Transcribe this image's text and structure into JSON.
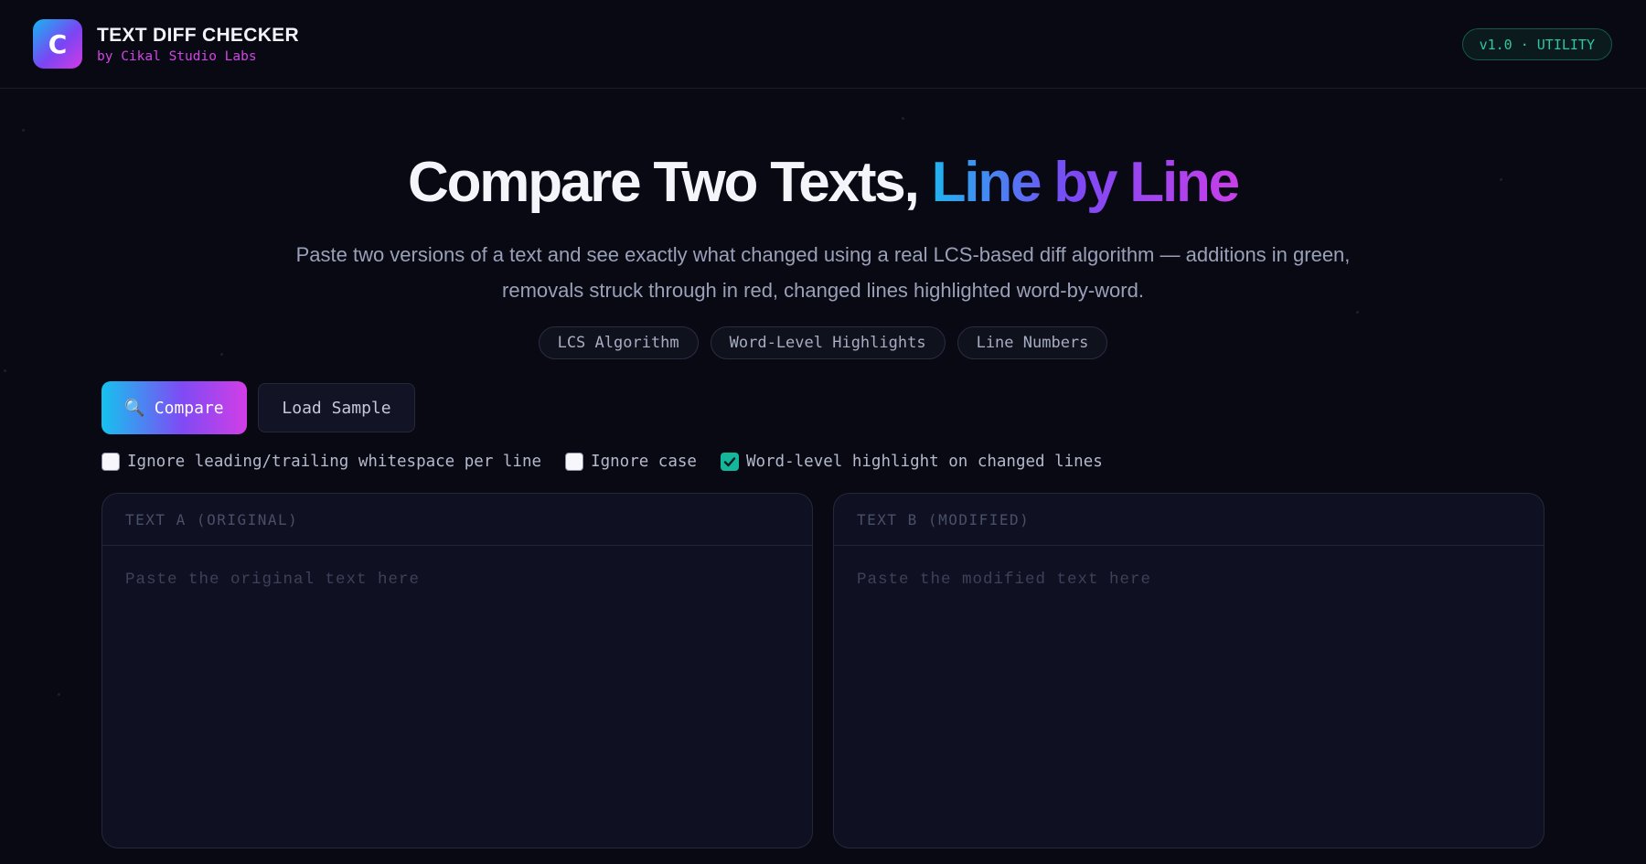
{
  "header": {
    "logo_letter": "C",
    "title": "TEXT DIFF CHECKER",
    "subtitle": "by Cikal Studio Labs",
    "version_badge": "v1.0 · UTILITY"
  },
  "hero": {
    "title_plain": "Compare Two Texts,",
    "title_highlight": "Line by Line",
    "description": "Paste two versions of a text and see exactly what changed using a real LCS-based diff algorithm — additions in green, removals struck through in red, changed lines highlighted word-by-word.",
    "chips": [
      "LCS Algorithm",
      "Word-Level Highlights",
      "Line Numbers"
    ]
  },
  "actions": {
    "compare_icon": "🔍",
    "compare_label": "Compare",
    "sample_label": "Load Sample"
  },
  "options": [
    {
      "label": "Ignore leading/trailing whitespace per line",
      "checked": false
    },
    {
      "label": "Ignore case",
      "checked": false
    },
    {
      "label": "Word-level highlight on changed lines",
      "checked": true
    }
  ],
  "panels": {
    "a": {
      "title": "TEXT A (ORIGINAL)",
      "placeholder": "Paste the original text here",
      "value": ""
    },
    "b": {
      "title": "TEXT B (MODIFIED)",
      "placeholder": "Paste the modified text here",
      "value": ""
    }
  },
  "colors": {
    "background": "#080913",
    "accent_cyan": "#1fb4f0",
    "accent_violet": "#7a49f5",
    "accent_magenta": "#c83fe8",
    "check_green": "#14b79a"
  }
}
